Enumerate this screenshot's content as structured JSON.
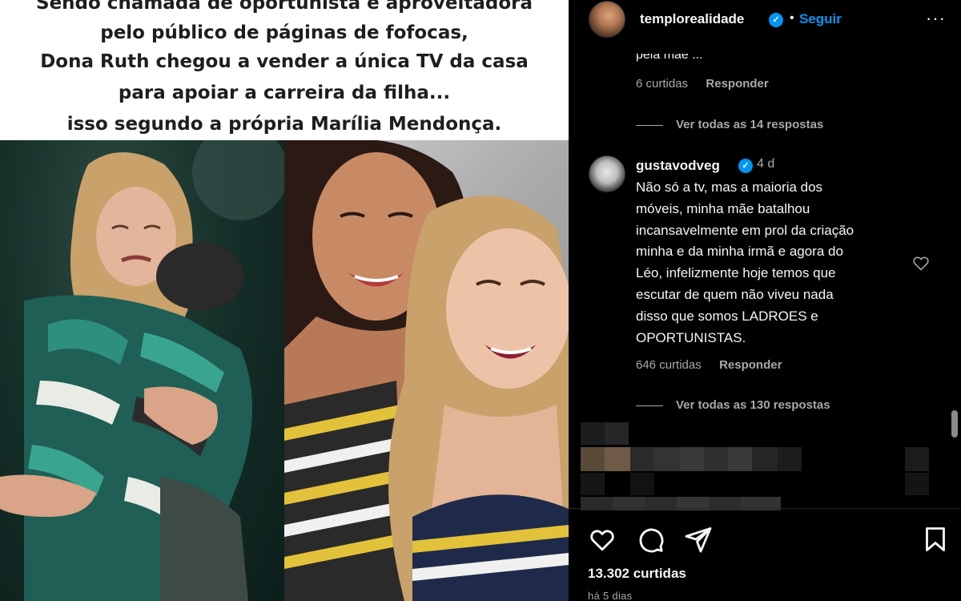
{
  "post": {
    "caption_lines": [
      "Sendo chamada de oportunista e aproveitadora",
      "pelo público de páginas de fofocas,",
      "Dona Ruth chegou a vender a única TV da casa",
      "para apoiar a carreira da filha...",
      "isso segundo a própria Marília Mendonça."
    ]
  },
  "header": {
    "username": "templorealidade",
    "dot": "•",
    "follow_label": "Seguir",
    "more_label": "···"
  },
  "previous_comment": {
    "partial_text": "pela mãe ...",
    "likes": "6 curtidas",
    "reply_label": "Responder",
    "view_replies": "Ver todas as 14 respostas"
  },
  "comment": {
    "username": "gustavodveg",
    "time": "4 d",
    "text_lines": [
      "Não só a tv, mas a maioria dos",
      "móveis, minha mãe batalhou",
      "incansavelmente em prol da criação",
      "minha e da minha irmã e agora do",
      "Léo, infelizmente hoje temos que",
      "escutar de quem não viveu nada",
      "disso que somos LADROES e",
      "OPORTUNISTAS."
    ],
    "likes": "646 curtidas",
    "reply_label": "Responder",
    "view_replies": "Ver todas as 130 respostas"
  },
  "footer": {
    "likes": "13.302 curtidas",
    "date": "há 5 dias"
  },
  "colors": {
    "background": "#000000",
    "link_blue": "#0095f6",
    "secondary_text": "#a8a8a8",
    "primary_text": "#f5f5f5"
  },
  "icons": [
    "verified-badge-icon",
    "more-icon",
    "heart-icon",
    "comment-icon",
    "share-icon",
    "bookmark-icon"
  ]
}
